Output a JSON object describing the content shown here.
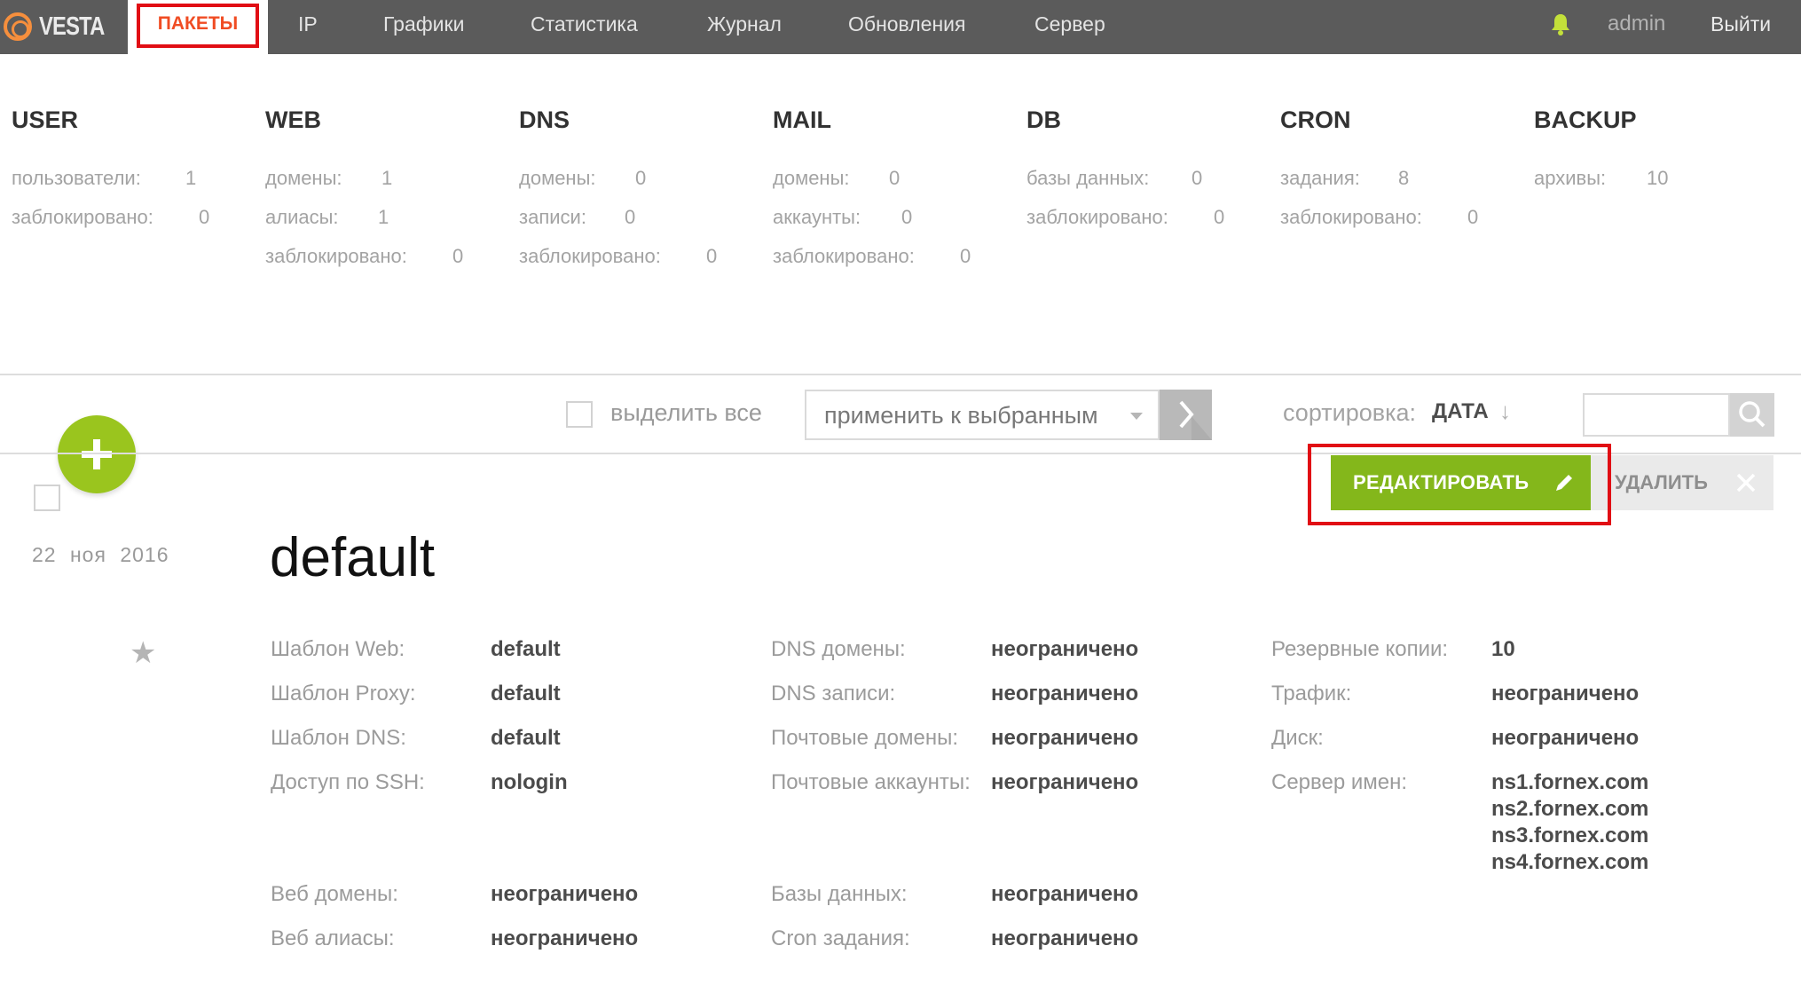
{
  "nav": {
    "logo": "VESTA",
    "items": [
      {
        "label": "ПАКЕТЫ",
        "active": true
      },
      {
        "label": "IP"
      },
      {
        "label": "Графики"
      },
      {
        "label": "Статистика"
      },
      {
        "label": "Журнал"
      },
      {
        "label": "Обновления"
      },
      {
        "label": "Сервер"
      }
    ],
    "user": "admin",
    "logout": "Выйти"
  },
  "stats": [
    {
      "title": "USER",
      "rows": [
        {
          "label": "пользователи:",
          "value": "1"
        },
        {
          "label": "заблокировано:",
          "value": "0"
        }
      ]
    },
    {
      "title": "WEB",
      "rows": [
        {
          "label": "домены:",
          "value": "1"
        },
        {
          "label": "алиасы:",
          "value": "1"
        },
        {
          "label": "заблокировано:",
          "value": "0"
        }
      ]
    },
    {
      "title": "DNS",
      "rows": [
        {
          "label": "домены:",
          "value": "0"
        },
        {
          "label": "записи:",
          "value": "0"
        },
        {
          "label": "заблокировано:",
          "value": "0"
        }
      ]
    },
    {
      "title": "MAIL",
      "rows": [
        {
          "label": "домены:",
          "value": "0"
        },
        {
          "label": "аккаунты:",
          "value": "0"
        },
        {
          "label": "заблокировано:",
          "value": "0"
        }
      ]
    },
    {
      "title": "DB",
      "rows": [
        {
          "label": "базы данных:",
          "value": "0"
        },
        {
          "label": "заблокировано:",
          "value": "0"
        }
      ]
    },
    {
      "title": "CRON",
      "rows": [
        {
          "label": "задания:",
          "value": "8"
        },
        {
          "label": "заблокировано:",
          "value": "0"
        }
      ]
    },
    {
      "title": "BACKUP",
      "rows": [
        {
          "label": "архивы:",
          "value": "10"
        }
      ]
    }
  ],
  "toolbar": {
    "select_all": "выделить все",
    "apply_placeholder": "применить к выбранным",
    "sort_label": "сортировка:",
    "sort_value": "ДАТА",
    "sort_arrow": "↓",
    "search_value": ""
  },
  "package": {
    "date_day": "22",
    "date_month": "ноя",
    "date_year": "2016",
    "star": "★",
    "name": "default",
    "edit_label": "РЕДАКТИРОВАТЬ",
    "delete_label": "УДАЛИТЬ",
    "col1": [
      {
        "label": "Шаблон Web:",
        "value": "default"
      },
      {
        "label": "Шаблон Proxy:",
        "value": "default"
      },
      {
        "label": "Шаблон DNS:",
        "value": "default"
      },
      {
        "label": "Доступ по SSH:",
        "value": "nologin"
      },
      {
        "label": "Веб домены:",
        "value": "неограничено"
      },
      {
        "label": "Веб алиасы:",
        "value": "неограничено"
      }
    ],
    "col2": [
      {
        "label": "DNS домены:",
        "value": "неограничено"
      },
      {
        "label": "DNS записи:",
        "value": "неограничено"
      },
      {
        "label": "Почтовые домены:",
        "value": "неограничено"
      },
      {
        "label": "Почтовые аккаунты:",
        "value": "неограничено"
      },
      {
        "label": "Базы данных:",
        "value": "неограничено"
      },
      {
        "label": "Cron задания:",
        "value": "неограничено"
      }
    ],
    "col3": [
      {
        "label": "Резервные копии:",
        "value": "10"
      },
      {
        "label": "Трафик:",
        "value": "неограничено"
      },
      {
        "label": "Диск:",
        "value": "неограничено"
      },
      {
        "label": "Сервер имен:",
        "value": "ns1.fornex.com"
      }
    ],
    "nameservers_extra": [
      "ns2.fornex.com",
      "ns3.fornex.com",
      "ns4.fornex.com"
    ]
  },
  "colors": {
    "nav_bg": "#5b5b5b",
    "accent_orange": "#f04c23",
    "highlight_red": "#e10e14",
    "add_green": "#9ac51e",
    "edit_green": "#84b71b"
  },
  "icons": [
    "vesta-logo-icon",
    "bell-icon",
    "plus-icon",
    "chevron-right-icon",
    "search-icon",
    "pencil-icon",
    "close-icon",
    "star-icon",
    "caret-down-icon"
  ]
}
